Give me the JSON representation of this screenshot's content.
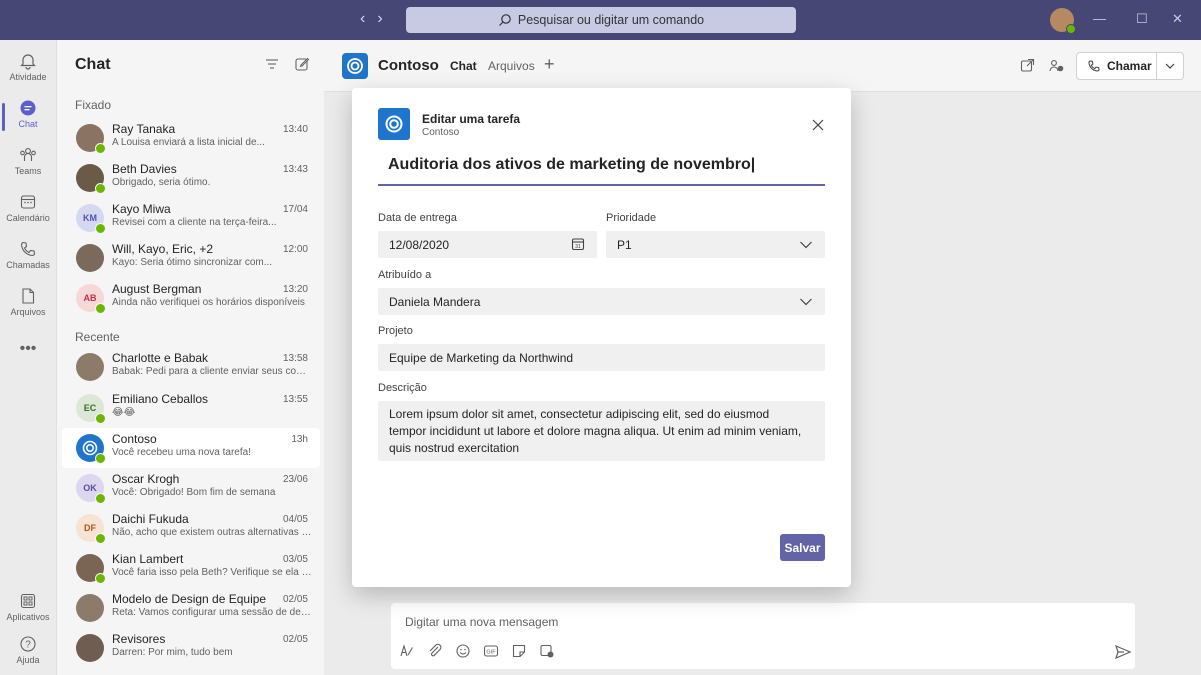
{
  "titlebar": {
    "search_placeholder": "Pesquisar ou digitar um comando",
    "nav_back": "‹",
    "nav_forward": "›",
    "minimize": "—",
    "maximize": "☐",
    "close": "✕"
  },
  "rail": {
    "items": [
      {
        "label": "Atividade",
        "icon": "bell-icon"
      },
      {
        "label": "Chat",
        "icon": "chat-icon",
        "active": true
      },
      {
        "label": "Teams",
        "icon": "teams-icon"
      },
      {
        "label": "Calendário",
        "icon": "calendar-icon"
      },
      {
        "label": "Chamadas",
        "icon": "phone-icon"
      },
      {
        "label": "Arquivos",
        "icon": "file-icon"
      }
    ],
    "more": "•••",
    "apps_label": "Aplicativos",
    "help_label": "Ajuda"
  },
  "chatlist": {
    "title": "Chat",
    "pinned_label": "Fixado",
    "recent_label": "Recente",
    "pinned": [
      {
        "name": "Ray Tanaka",
        "time": "13:40",
        "preview": "A Louisa enviará a lista inicial de...",
        "initials": ""
      },
      {
        "name": "Beth Davies",
        "time": "13:43",
        "preview": "Obrigado, seria ótimo.",
        "initials": ""
      },
      {
        "name": "Kayo Miwa",
        "time": "17/04",
        "preview": "Revisei com a cliente na terça-feira...",
        "initials": "KM"
      },
      {
        "name": "Will, Kayo, Eric, +2",
        "time": "12:00",
        "preview": "Kayo: Seria ótimo sincronizar com...",
        "initials": ""
      },
      {
        "name": "August Bergman",
        "time": "13:20",
        "preview": "Ainda não verifiquei os horários disponíveis",
        "initials": "AB"
      }
    ],
    "recent": [
      {
        "name": "Charlotte e Babak",
        "time": "13:58",
        "preview": "Babak: Pedi para a cliente enviar seus come...",
        "initials": ""
      },
      {
        "name": "Emiliano Ceballos",
        "time": "13:55",
        "preview": "😂😂",
        "initials": "EC"
      },
      {
        "name": "Contoso",
        "time": "13h",
        "preview": "Você recebeu uma nova tarefa!",
        "initials": ""
      },
      {
        "name": "Oscar Krogh",
        "time": "23/06",
        "preview": "Você: Obrigado! Bom fim de semana",
        "initials": "OK"
      },
      {
        "name": "Daichi Fukuda",
        "time": "04/05",
        "preview": "Não, acho que existem outras alternativas q...",
        "initials": "DF"
      },
      {
        "name": "Kian Lambert",
        "time": "03/05",
        "preview": "Você faria isso pela Beth? Verifique se ela es...",
        "initials": ""
      },
      {
        "name": "Modelo de Design de Equipe",
        "time": "02/05",
        "preview": "Reta: Vamos configurar uma sessão de deba...",
        "initials": ""
      },
      {
        "name": "Revisores",
        "time": "02/05",
        "preview": "Darren: Por mim, tudo bem",
        "initials": ""
      }
    ]
  },
  "main": {
    "app_name": "Contoso",
    "tabs": [
      {
        "label": "Chat",
        "active": true
      },
      {
        "label": "Arquivos",
        "active": false
      }
    ],
    "add_tab": "+",
    "call_label": "Chamar",
    "composer_placeholder": "Digitar uma nova mensagem"
  },
  "dialog": {
    "title": "Editar uma tarefa",
    "subtitle": "Contoso",
    "task_title": "Auditoria dos ativos de marketing de novembro|",
    "due_label": "Data de entrega",
    "due_value": "12/08/2020",
    "priority_label": "Prioridade",
    "priority_value": "P1",
    "assigned_label": "Atribuído a",
    "assigned_value": "Daniela Mandera",
    "project_label": "Projeto",
    "project_value": "Equipe de Marketing da Northwind",
    "description_label": "Descrição",
    "description_value": "Lorem ipsum dolor sit amet, consectetur adipiscing elit, sed do eiusmod tempor incididunt ut labore et dolore magna aliqua. Ut enim ad minim veniam, quis nostrud exercitation",
    "save_label": "Salvar"
  },
  "colors": {
    "titlebar": "#464775",
    "accent": "#6264a7",
    "brand_blue": "#1f75cb",
    "presence_available": "#6bb700"
  }
}
